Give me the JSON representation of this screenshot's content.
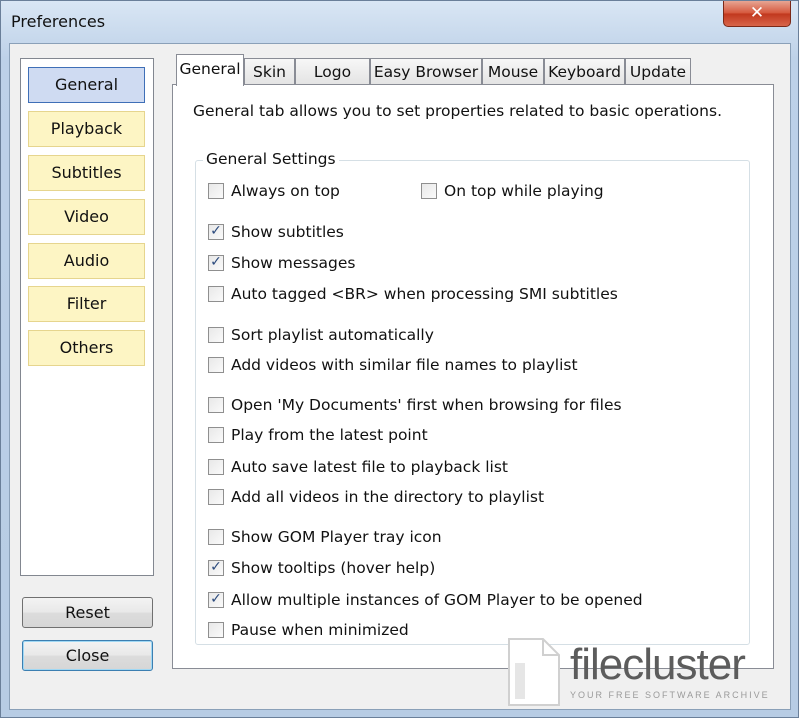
{
  "window": {
    "title": "Preferences",
    "close_label": "✕"
  },
  "sidebar": {
    "items": [
      {
        "label": "General"
      },
      {
        "label": "Playback"
      },
      {
        "label": "Subtitles"
      },
      {
        "label": "Video"
      },
      {
        "label": "Audio"
      },
      {
        "label": "Filter"
      },
      {
        "label": "Others"
      }
    ],
    "active": "General"
  },
  "buttons": {
    "reset": "Reset",
    "close": "Close"
  },
  "tabs": [
    "General",
    "Skin",
    "Logo",
    "Easy Browser",
    "Mouse",
    "Keyboard",
    "Update"
  ],
  "active_tab": "General",
  "panel": {
    "description": "General tab allows you to set properties related to basic operations.",
    "group_label": "General Settings",
    "options": [
      {
        "label": "Always on top",
        "checked": false
      },
      {
        "label": "On top while playing",
        "checked": false
      },
      {
        "label": "Show subtitles",
        "checked": true
      },
      {
        "label": "Show messages",
        "checked": true
      },
      {
        "label": "Auto tagged <BR> when processing SMI subtitles",
        "checked": false
      },
      {
        "label": "Sort playlist automatically",
        "checked": false
      },
      {
        "label": "Add videos with similar file names to playlist",
        "checked": false
      },
      {
        "label": "Open 'My Documents' first when browsing for files",
        "checked": false
      },
      {
        "label": "Play from the latest point",
        "checked": false
      },
      {
        "label": "Auto save latest file to playback list",
        "checked": false
      },
      {
        "label": "Add all videos in the directory to playlist",
        "checked": false
      },
      {
        "label": "Show GOM Player tray icon",
        "checked": false
      },
      {
        "label": "Show tooltips (hover help)",
        "checked": true
      },
      {
        "label": "Allow multiple instances of GOM Player to be opened",
        "checked": true
      },
      {
        "label": "Pause when minimized",
        "checked": false
      }
    ]
  },
  "watermark": {
    "brand": "filecluster",
    "tagline": "YOUR FREE SOFTWARE ARCHIVE"
  },
  "colors": {
    "sidebar_item_bg": "#fdf5c4",
    "sidebar_active_bg": "#cfdbf2",
    "close_red": "#d5553a"
  }
}
